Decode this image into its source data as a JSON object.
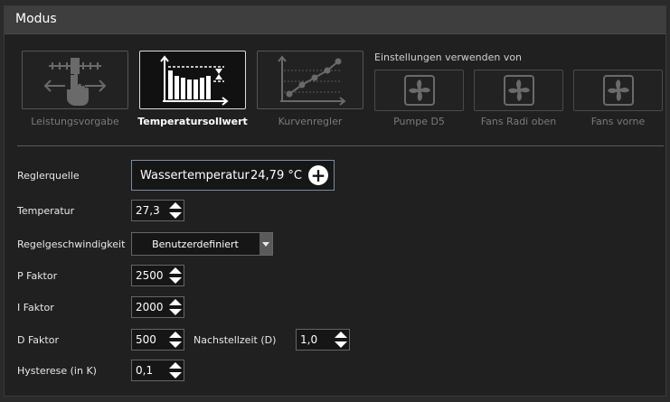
{
  "header": {
    "title": "Modus"
  },
  "modes": [
    {
      "label": "Leistungsvorgabe",
      "icon": "slider-hand-icon",
      "active": false
    },
    {
      "label": "Temperatursollwert",
      "icon": "bar-chart-setpoint-icon",
      "active": true
    },
    {
      "label": "Kurvenregler",
      "icon": "curve-chart-icon",
      "active": false
    }
  ],
  "use_settings": {
    "title": "Einstellungen verwenden von",
    "items": [
      {
        "label": "Pumpe D5",
        "icon": "fan-icon"
      },
      {
        "label": "Fans Radi oben",
        "icon": "fan-icon"
      },
      {
        "label": "Fans vorne",
        "icon": "fan-icon"
      }
    ]
  },
  "controller_source": {
    "label": "Reglerquelle",
    "name": "Wassertemperatur",
    "value": "24,79 °C"
  },
  "temperature": {
    "label": "Temperatur",
    "value": "27,3"
  },
  "speed": {
    "label": "Regelgeschwindigkeit",
    "value": "Benutzerdefiniert"
  },
  "p_factor": {
    "label": "P Faktor",
    "value": "2500"
  },
  "i_factor": {
    "label": "I Faktor",
    "value": "2000"
  },
  "d_factor": {
    "label": "D Faktor",
    "value": "500"
  },
  "reset_time": {
    "label": "Nachstellzeit (D)",
    "value": "1,0"
  },
  "hysteresis": {
    "label": "Hysterese (in K)",
    "value": "0,1"
  },
  "colors": {
    "background": "#202020",
    "header": "#3e3e3e",
    "active_border": "#dcdcdc",
    "source_border": "#7a8ba0"
  }
}
